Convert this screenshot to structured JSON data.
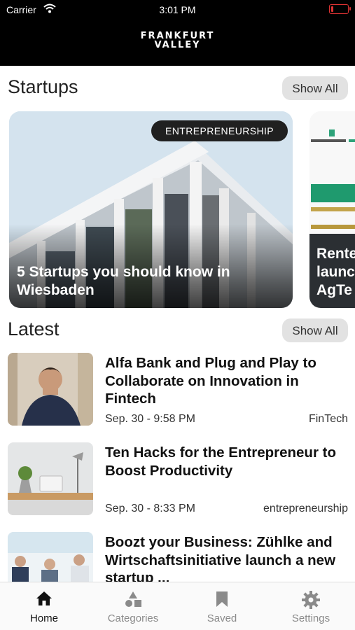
{
  "status_bar": {
    "carrier": "Carrier",
    "time": "3:01 PM"
  },
  "header": {
    "brand_line1": "FRANKFURT",
    "brand_line2": "VALLEY"
  },
  "startups": {
    "title": "Startups",
    "show_all": "Show All",
    "cards": [
      {
        "tag": "ENTREPRENEURSHIP",
        "title": "5 Startups you should know in Wiesbaden"
      },
      {
        "title": "Rente\nlaunc\nAgTe"
      }
    ]
  },
  "latest": {
    "title": "Latest",
    "show_all": "Show All",
    "articles": [
      {
        "title": "Alfa Bank and Plug and Play to Collaborate on Innovation in Fintech",
        "date": "Sep. 30 - 9:58 PM",
        "category": "FinTech"
      },
      {
        "title": "Ten Hacks for the Entrepreneur to Boost Productivity",
        "date": "Sep. 30 - 8:33 PM",
        "category": "entrepreneurship"
      },
      {
        "title": "Boozt your Business: Zühlke and Wirtschaftsinitiative launch a new startup ...",
        "date": "",
        "category": ""
      }
    ]
  },
  "tabbar": {
    "tabs": [
      {
        "label": "Home",
        "icon": "home-icon",
        "active": true
      },
      {
        "label": "Categories",
        "icon": "categories-icon",
        "active": false
      },
      {
        "label": "Saved",
        "icon": "bookmark-icon",
        "active": false
      },
      {
        "label": "Settings",
        "icon": "gear-icon",
        "active": false
      }
    ]
  },
  "colors": {
    "header_bg": "#000000",
    "pill_bg": "#e2e2e2",
    "tag_bg": "#202020",
    "battery": "#dd3333"
  }
}
